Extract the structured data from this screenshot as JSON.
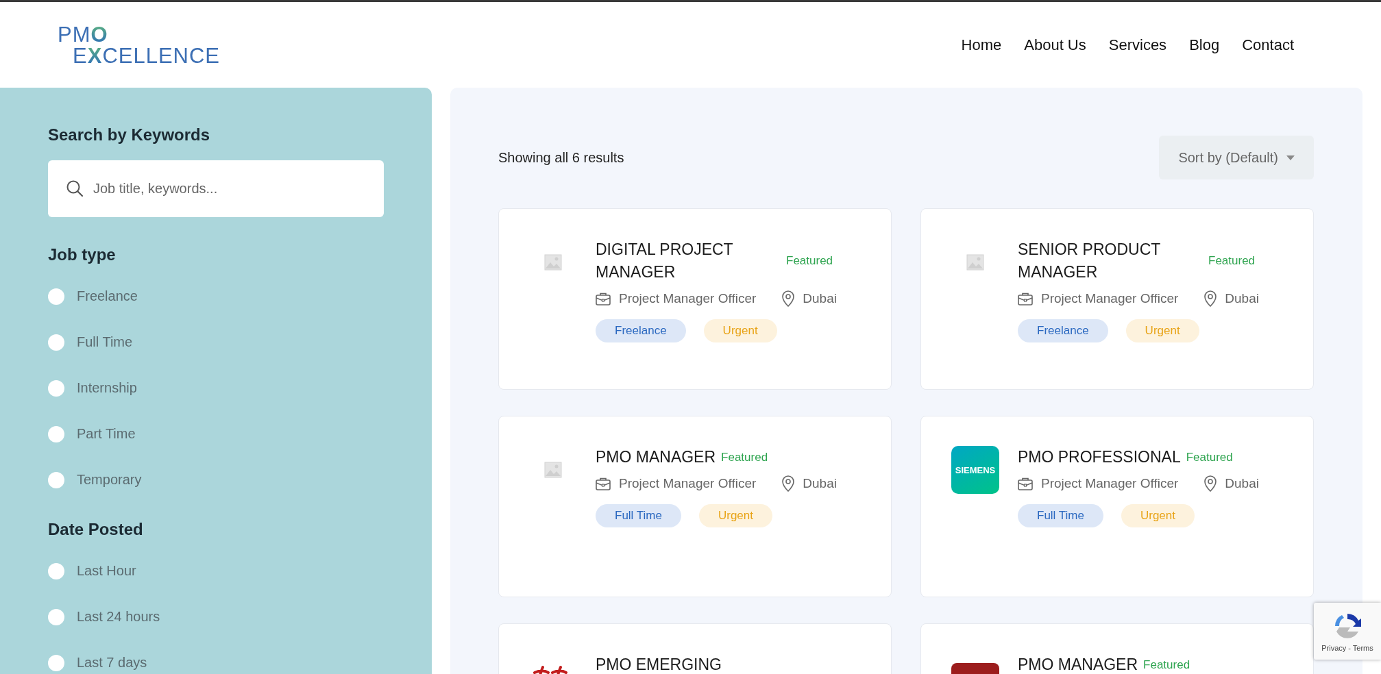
{
  "header": {
    "logo": [
      [
        {
          "text": "PM",
          "accent": false
        },
        {
          "text": "O",
          "accent": true
        }
      ],
      [
        {
          "text": "E",
          "accent": false
        },
        {
          "text": "X",
          "accent": true
        },
        {
          "text": "CELLENCE",
          "accent": false
        }
      ]
    ],
    "nav": [
      {
        "label": "Home"
      },
      {
        "label": "About Us"
      },
      {
        "label": "Services"
      },
      {
        "label": "Blog"
      },
      {
        "label": "Contact"
      }
    ]
  },
  "sidebar": {
    "search": {
      "heading": "Search by Keywords",
      "placeholder": "Job title, keywords..."
    },
    "filters": [
      {
        "heading": "Job type",
        "options": [
          {
            "label": "Freelance",
            "checked": false
          },
          {
            "label": "Full Time",
            "checked": false
          },
          {
            "label": "Internship",
            "checked": false
          },
          {
            "label": "Part Time",
            "checked": false
          },
          {
            "label": "Temporary",
            "checked": false
          }
        ]
      },
      {
        "heading": "Date Posted",
        "options": [
          {
            "label": "Last Hour",
            "checked": false
          },
          {
            "label": "Last 24 hours",
            "checked": false
          },
          {
            "label": "Last 7 days",
            "checked": false
          }
        ]
      }
    ]
  },
  "main": {
    "results_count": "Showing all 6 results",
    "sort": {
      "label": "Sort by (Default)"
    },
    "jobs": [
      {
        "title": "DIGITAL PROJECT MANAGER",
        "badge": "Featured",
        "logo": {
          "kind": "placeholder"
        },
        "category": "Project Manager Officer",
        "location": "Dubai",
        "tags": [
          {
            "label": "Freelance",
            "kind": "type"
          },
          {
            "label": "Urgent",
            "kind": "urgent"
          }
        ]
      },
      {
        "title": "SENIOR PRODUCT MANAGER",
        "badge": "Featured",
        "logo": {
          "kind": "placeholder"
        },
        "category": "Project Manager Officer",
        "location": "Dubai",
        "tags": [
          {
            "label": "Freelance",
            "kind": "type"
          },
          {
            "label": "Urgent",
            "kind": "urgent"
          }
        ]
      },
      {
        "title": "PMO MANAGER",
        "badge": "Featured",
        "logo": {
          "kind": "placeholder"
        },
        "category": "Project Manager Officer",
        "location": "Dubai",
        "tags": [
          {
            "label": "Full Time",
            "kind": "type"
          },
          {
            "label": "Urgent",
            "kind": "urgent"
          }
        ]
      },
      {
        "title": "PMO PROFESSIONAL",
        "badge": "Featured",
        "logo": {
          "kind": "brand",
          "text": "SIEMENS"
        },
        "category": "Project Manager Officer",
        "location": "Dubai",
        "tags": [
          {
            "label": "Full Time",
            "kind": "type"
          },
          {
            "label": "Urgent",
            "kind": "urgent"
          }
        ]
      },
      {
        "title": "PMO EMERGING",
        "logo": {
          "kind": "script"
        }
      },
      {
        "title": "PMO MANAGER",
        "badge": "Featured",
        "logo": {
          "kind": "red"
        }
      }
    ]
  },
  "recaptcha": {
    "label": "Privacy - Terms"
  }
}
